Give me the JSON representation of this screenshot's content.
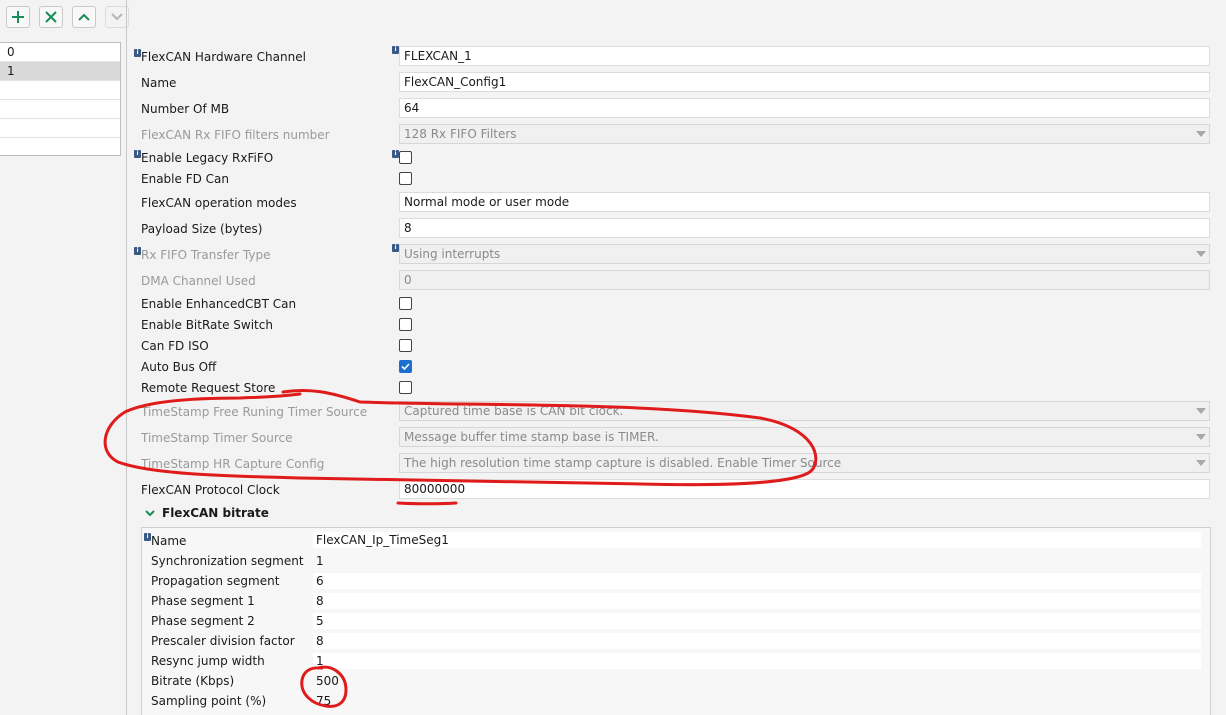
{
  "toolbar": {
    "add_icon": "plus-icon",
    "remove_icon": "close-icon",
    "up_icon": "chevron-up-icon",
    "down_icon": "chevron-down-icon",
    "accent": "#1a8c57"
  },
  "left_list": {
    "items": [
      "0",
      "1",
      "",
      "",
      ""
    ]
  },
  "properties": {
    "hw_channel": {
      "label": "FlexCAN Hardware Channel",
      "value": "FLEXCAN_1"
    },
    "name": {
      "label": "Name",
      "value": "FlexCAN_Config1"
    },
    "number_of_mb": {
      "label": "Number Of MB",
      "value": "64"
    },
    "rx_fifo_filters": {
      "label": "FlexCAN Rx FIFO filters number",
      "value": "128 Rx FIFO Filters"
    },
    "legacy_rxfifo": {
      "label": "Enable Legacy RxFiFO",
      "checked": false
    },
    "enable_fd": {
      "label": "Enable FD Can",
      "checked": false
    },
    "operation_modes": {
      "label": "FlexCAN operation modes",
      "value": "Normal mode or user mode"
    },
    "payload_size": {
      "label": "Payload Size (bytes)",
      "value": "8"
    },
    "rx_fifo_transfer": {
      "label": "Rx FIFO Transfer Type",
      "value": "Using interrupts"
    },
    "dma_channel": {
      "label": "DMA Channel Used",
      "value": "0"
    },
    "enhanced_cbt": {
      "label": "Enable EnhancedCBT Can",
      "checked": false
    },
    "bitrate_switch": {
      "label": "Enable BitRate Switch",
      "checked": false
    },
    "fd_iso": {
      "label": "Can FD ISO",
      "checked": false
    },
    "auto_bus_off": {
      "label": "Auto Bus Off",
      "checked": true
    },
    "remote_request": {
      "label": "Remote Request Store",
      "checked": false
    },
    "ts_free_running": {
      "label": "TimeStamp Free Runing Timer Source",
      "value": "Captured time base is CAN bit clock."
    },
    "ts_timer_source": {
      "label": "TimeStamp Timer Source",
      "value": "Message buffer time stamp base is TIMER."
    },
    "ts_hr_capture": {
      "label": "TimeStamp HR Capture Config",
      "value": "The high resolution time stamp capture is disabled. Enable Timer Source"
    },
    "protocol_clock": {
      "label": "FlexCAN Protocol Clock",
      "value": "80000000"
    }
  },
  "bitrate": {
    "title": "FlexCAN bitrate",
    "name": {
      "label": "Name",
      "value": "FlexCAN_Ip_TimeSeg1"
    },
    "sync_segment": {
      "label": "Synchronization segment",
      "value": "1"
    },
    "prop_segment": {
      "label": "Propagation segment",
      "value": "6"
    },
    "phase_segment1": {
      "label": "Phase segment 1",
      "value": "8"
    },
    "phase_segment2": {
      "label": "Phase segment 2",
      "value": "5"
    },
    "prescaler": {
      "label": "Prescaler division factor",
      "value": "8"
    },
    "resync_jump": {
      "label": "Resync jump width",
      "value": "1"
    },
    "bitrate_kbps": {
      "label": "Bitrate (Kbps)",
      "value": "500"
    },
    "sampling_point": {
      "label": "Sampling point (%)",
      "value": "75"
    }
  },
  "annotation_color": "#e01b1b"
}
